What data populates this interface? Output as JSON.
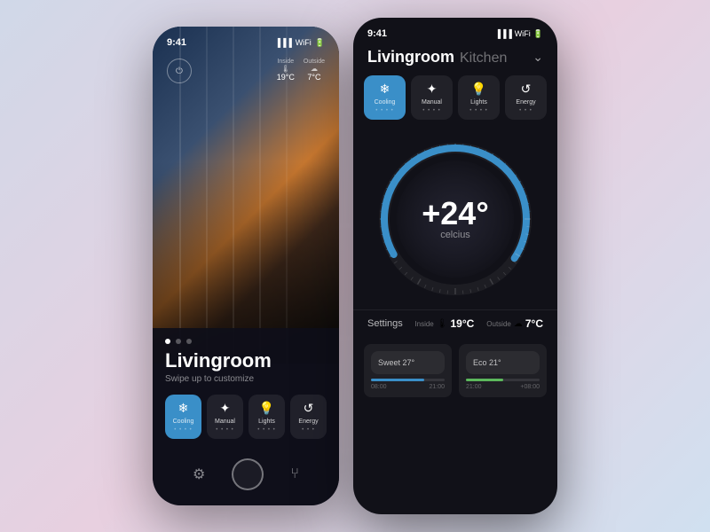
{
  "left_phone": {
    "status_time": "9:41",
    "inside_label": "Inside",
    "inside_temp": "19°C",
    "outside_label": "Outside",
    "outside_temp": "7°C",
    "dots": [
      "active",
      "inactive",
      "inactive"
    ],
    "room_title": "Livingroom",
    "room_subtitle": "Swipe up to customize",
    "controls": [
      {
        "icon": "❄",
        "label": "Cooling",
        "dots": "• • • •",
        "active": true
      },
      {
        "icon": "✦",
        "label": "Manual",
        "dots": "• • • •",
        "active": false
      },
      {
        "icon": "💡",
        "label": "Lights",
        "dots": "• • • •",
        "active": false
      },
      {
        "icon": "↺",
        "label": "Energy",
        "dots": "• • •",
        "active": false
      }
    ]
  },
  "right_phone": {
    "status_time": "9:41",
    "room_main": "Livingroom",
    "room_sub": "Kitchen",
    "modes": [
      {
        "icon": "❄",
        "label": "Cooling",
        "dots": "• • • •",
        "active": true
      },
      {
        "icon": "✦",
        "label": "Manual",
        "dots": "• • • •",
        "active": false
      },
      {
        "icon": "💡",
        "label": "Lights",
        "dots": "• • • •",
        "active": false
      },
      {
        "icon": "↺",
        "label": "Energy",
        "dots": "• • •",
        "active": false
      }
    ],
    "temperature": "+24°",
    "unit": "celcius",
    "settings_label": "Settings",
    "inside_label": "Inside",
    "inside_temp": "19°C",
    "outside_label": "Outside",
    "outside_temp": "7°C",
    "presets": [
      {
        "name": "Sweet 27°",
        "range_start": "08:00",
        "range_end": "21:00",
        "fill_pct": 72,
        "type": "sweet"
      },
      {
        "name": "Eco 21°",
        "range_start": "21:00",
        "range_end": "+08:00",
        "fill_pct": 50,
        "type": "eco"
      }
    ]
  }
}
